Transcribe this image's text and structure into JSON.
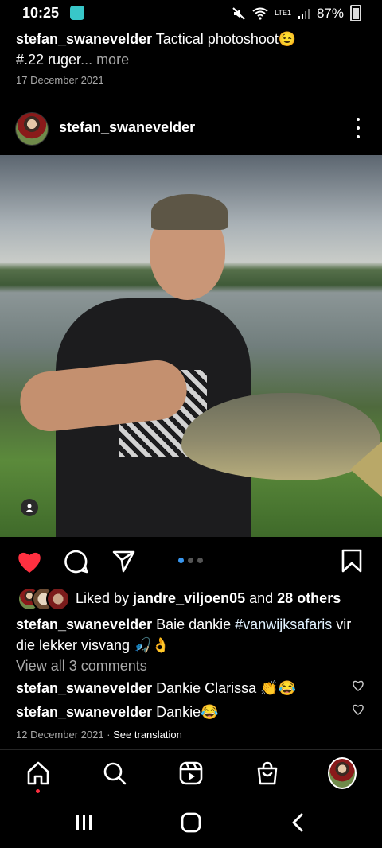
{
  "status_bar": {
    "time": "10:25",
    "battery": "87%",
    "network": "LTE1"
  },
  "top_caption": {
    "username": "stefan_swanevelder",
    "text": "Tactical photoshoot😉",
    "line2": "#.22 ruger",
    "more": "... more",
    "date": "17 December 2021"
  },
  "post": {
    "username": "stefan_swanevelder",
    "likes": {
      "prefix": "Liked by ",
      "user": "jandre_viljoen05",
      "and": " and ",
      "others": "28 others"
    },
    "caption": {
      "username": "stefan_swanevelder",
      "text_before": " Baie dankie ",
      "hashtag": "#vanwijksafaris",
      "text_after": "  vir die lekker visvang 🎣👌"
    },
    "view_all": "View all 3 comments",
    "comments": [
      {
        "username": "stefan_swanevelder",
        "text": " Dankie Clarissa 👏😂"
      },
      {
        "username": "stefan_swanevelder",
        "text": " Dankie😂"
      }
    ],
    "date": "12 December 2021",
    "separator": " · ",
    "see_translation": "See translation",
    "carousel": {
      "count": 3,
      "current": 1
    }
  },
  "colors": {
    "like_red": "#ff3040",
    "accent_blue": "#3897f0",
    "muted": "#a8a8a8"
  },
  "nav": {
    "items": [
      "home-icon",
      "search-icon",
      "reels-icon",
      "shop-icon",
      "profile-avatar"
    ],
    "active": "home-icon"
  }
}
